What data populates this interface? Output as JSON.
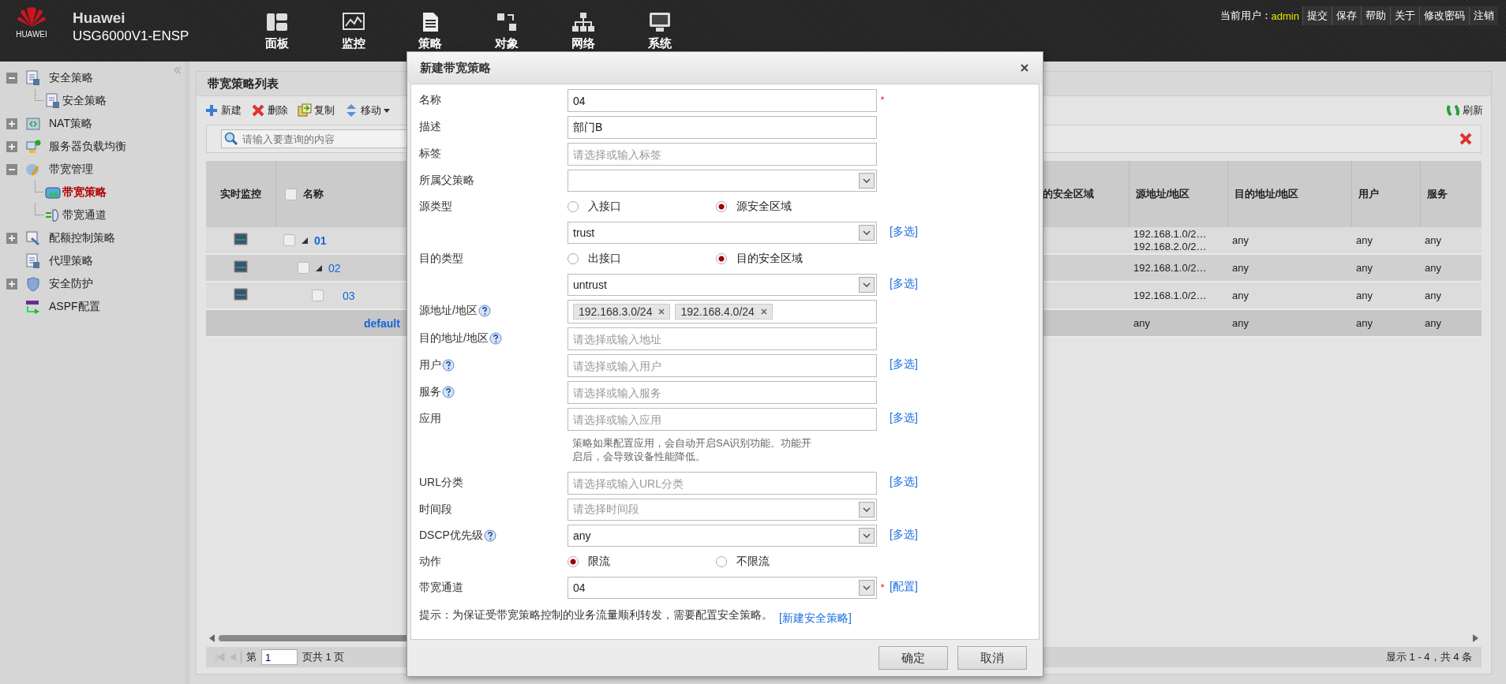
{
  "header": {
    "logo_caption": "HUAWEI",
    "brand": "Huawei",
    "product": "USG6000V1-ENSP",
    "nav": [
      {
        "label": "面板"
      },
      {
        "label": "监控"
      },
      {
        "label": "策略"
      },
      {
        "label": "对象"
      },
      {
        "label": "网络"
      },
      {
        "label": "系统"
      }
    ],
    "user_label": "当前用户：",
    "user": "admin",
    "links": [
      "提交",
      "保存",
      "帮助",
      "关于",
      "修改密码",
      "注销"
    ]
  },
  "sidebar": {
    "items": [
      {
        "label": "安全策略",
        "expanded": true,
        "children": [
          {
            "label": "安全策略",
            "selected": false
          }
        ]
      },
      {
        "label": "NAT策略",
        "expanded": false
      },
      {
        "label": "服务器负载均衡",
        "expanded": false
      },
      {
        "label": "带宽管理",
        "expanded": true,
        "children": [
          {
            "label": "带宽策略",
            "selected": true
          },
          {
            "label": "带宽通道",
            "selected": false
          }
        ]
      },
      {
        "label": "配额控制策略",
        "expanded": false
      },
      {
        "label": "代理策略"
      },
      {
        "label": "安全防护",
        "expanded": false
      },
      {
        "label": "ASPF配置"
      }
    ]
  },
  "panel": {
    "title": "带宽策略列表",
    "toolbar": [
      {
        "label": "新建",
        "kind": "add"
      },
      {
        "label": "删除",
        "kind": "delete"
      },
      {
        "label": "复制",
        "kind": "copy"
      },
      {
        "label": "移动",
        "kind": "move"
      }
    ],
    "refresh": "刷新",
    "search": {
      "placeholder": "请输入要查询的内容"
    },
    "table": {
      "select_all_checked": false,
      "columns": [
        "实时监控",
        "名称",
        "的安全区域",
        "源地址/地区",
        "目的地址/地区",
        "用户",
        "服务"
      ],
      "rows": [
        {
          "name": "01",
          "checked": false,
          "expanded": true,
          "source": [
            "192.168.1.0/2…",
            "192.168.2.0/2…"
          ],
          "destination": "any",
          "user": "any",
          "service": "any",
          "children": [
            {
              "name": "02",
              "checked": false,
              "expanded": true,
              "source": [
                "192.168.1.0/2…"
              ],
              "destination": "any",
              "user": "any",
              "service": "any",
              "children": [
                {
                  "name": "03",
                  "checked": false,
                  "source": [
                    "192.168.1.0/2…"
                  ],
                  "destination": "any",
                  "user": "any",
                  "service": "any"
                }
              ]
            }
          ]
        }
      ],
      "default_row": {
        "name": "default",
        "source": [
          "any"
        ],
        "destination": "any",
        "user": "any",
        "service": "any"
      }
    },
    "pager": {
      "before": "第",
      "page": "1",
      "after": "页共 1 页",
      "summary": "显示 1 - 4，共 4 条"
    }
  },
  "dialog": {
    "title": "新建带宽策略",
    "fields": [
      {
        "kind": "text",
        "label": "名称",
        "value": "04",
        "required_mark": "*"
      },
      {
        "kind": "text",
        "label": "描述",
        "value": "部门B"
      },
      {
        "kind": "text",
        "label": "标签",
        "placeholder": "请选择或输入标签"
      },
      {
        "kind": "select",
        "label": "所属父策略"
      },
      {
        "kind": "radio",
        "label": "源类型",
        "options": [
          {
            "label": "入接口",
            "selected": false
          },
          {
            "label": "源安全区域",
            "selected": true
          }
        ]
      },
      {
        "kind": "select",
        "value": "trust",
        "link": "[多选]"
      },
      {
        "kind": "radio",
        "label": "目的类型",
        "options": [
          {
            "label": "出接口",
            "selected": false
          },
          {
            "label": "目的安全区域",
            "selected": true
          }
        ]
      },
      {
        "kind": "select",
        "value": "untrust",
        "link": "[多选]"
      },
      {
        "kind": "tags",
        "label": "源地址/地区",
        "help": true,
        "tags": [
          "192.168.3.0/24",
          "192.168.4.0/24"
        ]
      },
      {
        "kind": "text",
        "label": "目的地址/地区",
        "help": true,
        "placeholder": "请选择或输入地址"
      },
      {
        "kind": "text",
        "label": "用户",
        "help": true,
        "placeholder": "请选择或输入用户",
        "link": "[多选]"
      },
      {
        "kind": "text",
        "label": "服务",
        "help": true,
        "placeholder": "请选择或输入服务"
      },
      {
        "kind": "text",
        "label": "应用",
        "placeholder": "请选择或输入应用",
        "link": "[多选]"
      },
      {
        "kind": "note",
        "text": "策略如果配置应用，会自动开启SA识别功能。功能开启后，会导致设备性能降低。"
      },
      {
        "kind": "text",
        "label": "URL分类",
        "placeholder": "请选择或输入URL分类",
        "link": "[多选]"
      },
      {
        "kind": "select",
        "label": "时间段",
        "placeholder": "请选择时间段"
      },
      {
        "kind": "select",
        "label": "DSCP优先级",
        "help": true,
        "value": "any",
        "link": "[多选]"
      },
      {
        "kind": "radio",
        "label": "动作",
        "options": [
          {
            "label": "限流",
            "selected": true
          },
          {
            "label": "不限流",
            "selected": false
          }
        ]
      },
      {
        "kind": "select",
        "label": "带宽通道",
        "value": "04",
        "required_mark": "*",
        "link": "[配置]"
      }
    ],
    "hint": {
      "text": "提示：为保证受带宽策略控制的业务流量顺利转发，需要配置安全策略。",
      "link": "[新建安全策略]"
    },
    "buttons": [
      "确定",
      "取消"
    ]
  }
}
